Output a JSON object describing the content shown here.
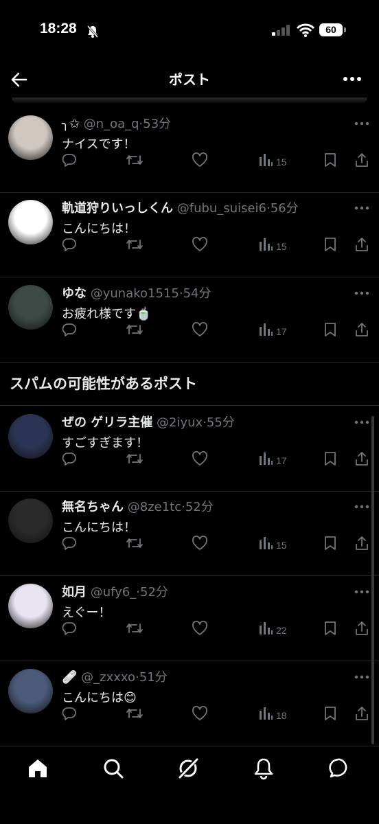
{
  "status_bar": {
    "time": "18:28",
    "battery": "60"
  },
  "header": {
    "title": "ポスト"
  },
  "posts": [
    {
      "name": "╮✩",
      "handle": "@n_oa_q",
      "time": "53分",
      "text": "ナイスです！",
      "views": "15",
      "avatar_color": "#cfc6c0"
    },
    {
      "name": "軌道狩りいっしくん",
      "handle": "@fubu_suisei6",
      "time": "56分",
      "text": "こんにちは！",
      "views": "15",
      "avatar_color": "#ffffff"
    },
    {
      "name": "ゆな",
      "handle": "@yunako1515",
      "time": "54分",
      "text": "お疲れ様です🍵",
      "views": "17",
      "avatar_color": "#3d4a45"
    }
  ],
  "spam_section": {
    "title": "スパムの可能性があるポスト"
  },
  "spam_posts": [
    {
      "name": "ぜの ゲリラ主催",
      "handle": "@2iyux",
      "time": "55分",
      "text": "すごすぎます！",
      "views": "17",
      "avatar_color": "#2b3454"
    },
    {
      "name": "無名ちゃん",
      "handle": "@8ze1tc",
      "time": "52分",
      "text": "こんにちは！",
      "views": "15",
      "avatar_color": "#2a2a2a"
    },
    {
      "name": "如月",
      "handle": "@ufy6_",
      "time": "52分",
      "text": "えぐー！",
      "views": "22",
      "avatar_color": "#e8e4f2"
    },
    {
      "name": "🩹",
      "handle": "@_zxxxo",
      "time": "51分",
      "text": "こんにちは😊",
      "views": "18",
      "avatar_color": "#4a5a78"
    }
  ],
  "colors": {
    "background": "#000000",
    "text": "#e7e9ea",
    "muted": "#71767b",
    "divider": "#262626"
  },
  "icons": [
    "back-arrow-icon",
    "more-icon",
    "reply-icon",
    "retweet-icon",
    "like-icon",
    "views-icon",
    "bookmark-icon",
    "share-icon",
    "home-icon",
    "search-icon",
    "grok-icon",
    "notifications-icon",
    "messages-icon"
  ]
}
